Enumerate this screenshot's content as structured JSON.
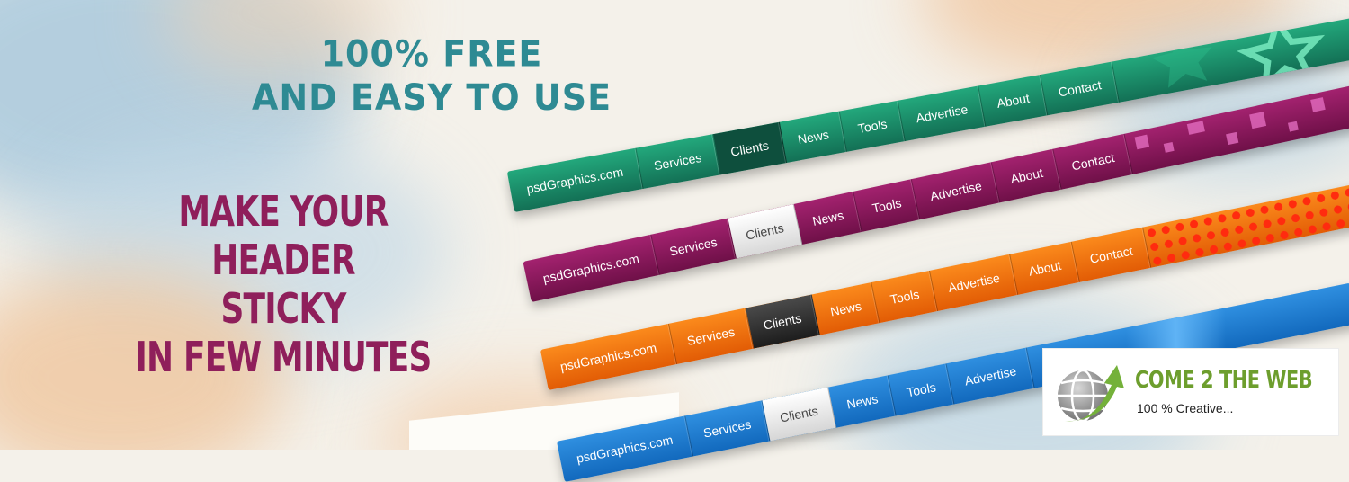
{
  "headline": "100% FREE\nAND EASY TO USE",
  "headline_lines": [
    "100% FREE",
    "AND EASY TO USE"
  ],
  "tagline_lines": [
    "MAKE YOUR HEADER",
    "STICKY",
    "IN FEW MINUTES"
  ],
  "navbars": {
    "green": {
      "brand": "psdGraphics.com",
      "items": [
        "Services",
        "Clients",
        "News",
        "Tools",
        "Advertise",
        "About",
        "Contact"
      ],
      "active": "Clients",
      "color": "#1b8f6a"
    },
    "purple": {
      "brand": "psdGraphics.com",
      "items": [
        "Services",
        "Clients",
        "News",
        "Tools",
        "Advertise",
        "About",
        "Contact"
      ],
      "active": "Clients",
      "color": "#8c1a5e"
    },
    "orange": {
      "brand": "psdGraphics.com",
      "items": [
        "Services",
        "Clients",
        "News",
        "Tools",
        "Advertise",
        "About",
        "Contact"
      ],
      "active": "Clients",
      "color": "#f07511"
    },
    "blue": {
      "brand": "psdGraphics.com",
      "items": [
        "Services",
        "Clients",
        "News",
        "Tools",
        "Advertise"
      ],
      "active": "Clients",
      "color": "#1f7fd3"
    }
  },
  "logo": {
    "title": "COME 2 THE WEB",
    "subtitle": "100 % Creative...",
    "icon": "globe-arrow-icon"
  },
  "colors": {
    "headline": "#2e8a93",
    "tagline": "#8f1f5b"
  }
}
